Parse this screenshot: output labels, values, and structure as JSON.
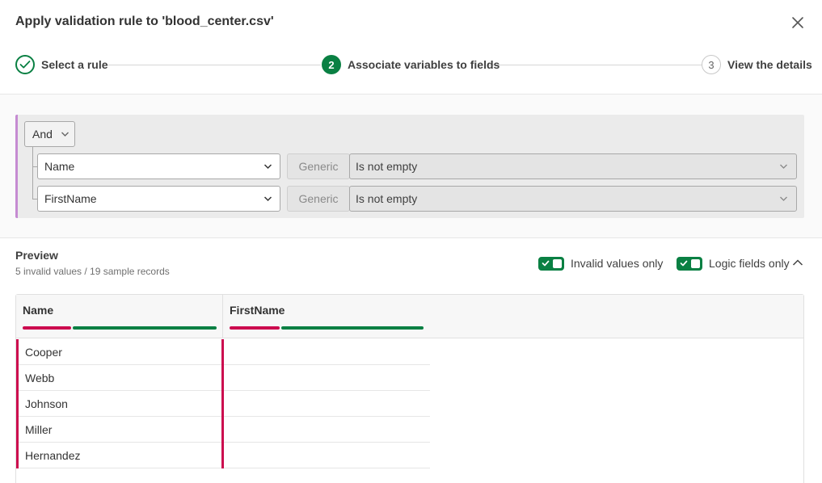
{
  "dialog": {
    "title": "Apply validation rule to 'blood_center.csv'",
    "close_icon": "close-icon"
  },
  "stepper": {
    "steps": [
      {
        "number": "1",
        "label": "Select a rule",
        "state": "done"
      },
      {
        "number": "2",
        "label": "Associate variables to fields",
        "state": "active"
      },
      {
        "number": "3",
        "label": "View the details",
        "state": "todo"
      }
    ]
  },
  "rule": {
    "operator": "And",
    "conditions": [
      {
        "field": "Name",
        "type_tag": "Generic",
        "condition": "Is not empty"
      },
      {
        "field": "FirstName",
        "type_tag": "Generic",
        "condition": "Is not empty"
      }
    ]
  },
  "preview": {
    "title": "Preview",
    "summary": "5 invalid values / 19 sample records",
    "toggles": [
      {
        "label": "Invalid values only",
        "checked": true
      },
      {
        "label": "Logic fields only",
        "checked": true
      }
    ],
    "columns": [
      {
        "label": "Name",
        "invalid_ratio": 0.25,
        "valid_ratio": 0.75
      },
      {
        "label": "FirstName",
        "invalid_ratio": 0.26,
        "valid_ratio": 0.74
      }
    ],
    "rows": [
      {
        "name": "Cooper",
        "first_name": ""
      },
      {
        "name": "Webb",
        "first_name": ""
      },
      {
        "name": "Johnson",
        "first_name": ""
      },
      {
        "name": "Miller",
        "first_name": ""
      },
      {
        "name": "Hernandez",
        "first_name": ""
      }
    ]
  },
  "colors": {
    "accent": "#0a8043",
    "invalid": "#cc0a4e",
    "group_border": "#c58bd2"
  }
}
